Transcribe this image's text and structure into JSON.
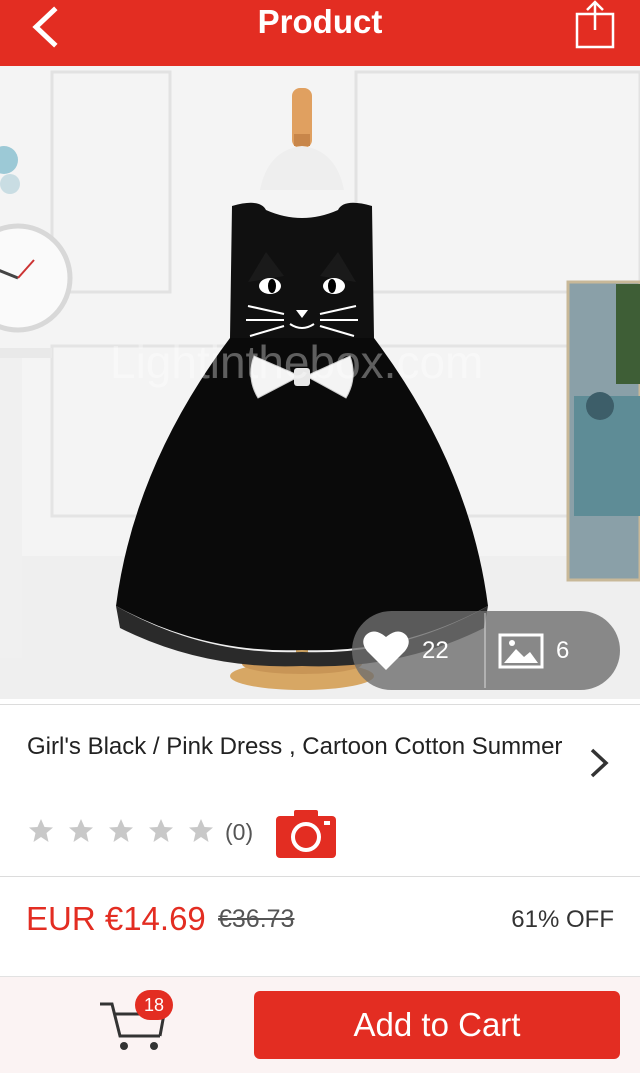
{
  "header": {
    "title": "Product"
  },
  "product": {
    "name": "Girl's Black / Pink Dress , Cartoon Cotton Summer",
    "rating_count": "(0)",
    "price": "EUR €14.69",
    "original_price": "€36.73",
    "discount": "61% OFF",
    "watermark": "Lightinthebox.com"
  },
  "image_stats": {
    "favorites": "22",
    "photos": "6"
  },
  "cart": {
    "count": "18",
    "add_label": "Add to Cart"
  },
  "colors": {
    "brand": "#e32d22",
    "pill": "#6e6e6e"
  }
}
